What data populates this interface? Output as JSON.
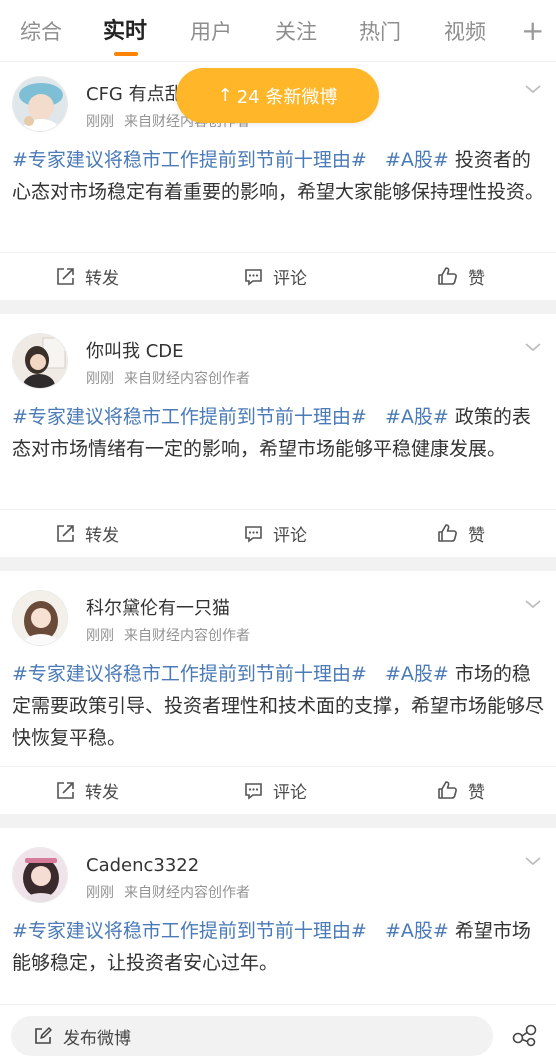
{
  "tabs": [
    {
      "label": "综合",
      "active": false
    },
    {
      "label": "实时",
      "active": true
    },
    {
      "label": "用户",
      "active": false
    },
    {
      "label": "关注",
      "active": false
    },
    {
      "label": "热门",
      "active": false
    },
    {
      "label": "视频",
      "active": false
    }
  ],
  "tab_add": "+",
  "toast": {
    "arrow": "↑",
    "text": "24 条新微博"
  },
  "posts": [
    {
      "username": "CFG 有点乱",
      "time": "刚刚",
      "source": "来自财经内容创作者",
      "topic1": "#专家建议将稳市工作提前到节前十理由#",
      "topic2": "#A股#",
      "text": "投资者的心态对市场稳定有着重要的影响，希望大家能够保持理性投资。",
      "repost": "转发",
      "comment": "评论",
      "like": "赞"
    },
    {
      "username": "你叫我 CDE",
      "time": "刚刚",
      "source": "来自财经内容创作者",
      "topic1": "#专家建议将稳市工作提前到节前十理由#",
      "topic2": "#A股#",
      "text": "政策的表态对市场情绪有一定的影响，希望市场能够平稳健康发展。",
      "repost": "转发",
      "comment": "评论",
      "like": "赞"
    },
    {
      "username": "科尔黛伦有一只猫",
      "time": "刚刚",
      "source": "来自财经内容创作者",
      "topic1": "#专家建议将稳市工作提前到节前十理由#",
      "topic2": "#A股#",
      "text": "市场的稳定需要政策引导、投资者理性和技术面的支撑，希望市场能够尽快恢复平稳。",
      "repost": "转发",
      "comment": "评论",
      "like": "赞"
    },
    {
      "username": "Cadenc3322",
      "time": "刚刚",
      "source": "来自财经内容创作者",
      "topic1": "#专家建议将稳市工作提前到节前十理由#",
      "topic2": "#A股#",
      "text": "希望市场能够稳定，让投资者安心过年。"
    }
  ],
  "bottom": {
    "compose": "发布微博"
  },
  "colors": {
    "accent": "#ff8200",
    "toast": "#ffb628",
    "topic": "#4a7ab7"
  },
  "icons": [
    "repost-icon",
    "comment-icon",
    "like-icon",
    "chevron-down-icon",
    "compose-icon",
    "share-icon"
  ]
}
